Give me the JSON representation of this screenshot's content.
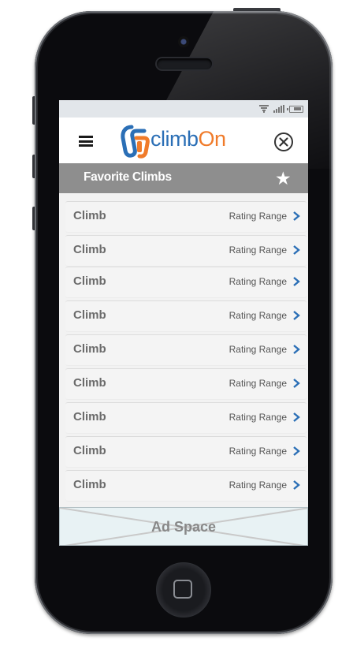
{
  "app": {
    "logo_text": "climb",
    "logo_text_suffix": "On",
    "brand_blue": "#2b6fb6",
    "brand_orange": "#f07b2a"
  },
  "status_bar": {
    "icons": [
      "wifi-icon",
      "signal-icon",
      "battery-icon"
    ]
  },
  "header": {
    "menu_icon": "hamburger-menu-icon",
    "close_icon": "close-circle-icon"
  },
  "section": {
    "title": "Favorite Climbs",
    "star_icon": "star-icon",
    "bar_color": "#8e8e8e"
  },
  "climbs": [
    {
      "name": "Climb",
      "rating": "Rating Range"
    },
    {
      "name": "Climb",
      "rating": "Rating Range"
    },
    {
      "name": "Climb",
      "rating": "Rating Range"
    },
    {
      "name": "Climb",
      "rating": "Rating Range"
    },
    {
      "name": "Climb",
      "rating": "Rating Range"
    },
    {
      "name": "Climb",
      "rating": "Rating Range"
    },
    {
      "name": "Climb",
      "rating": "Rating Range"
    },
    {
      "name": "Climb",
      "rating": "Rating Range"
    },
    {
      "name": "Climb",
      "rating": "Rating Range"
    }
  ],
  "ad": {
    "label": "Ad Space"
  }
}
